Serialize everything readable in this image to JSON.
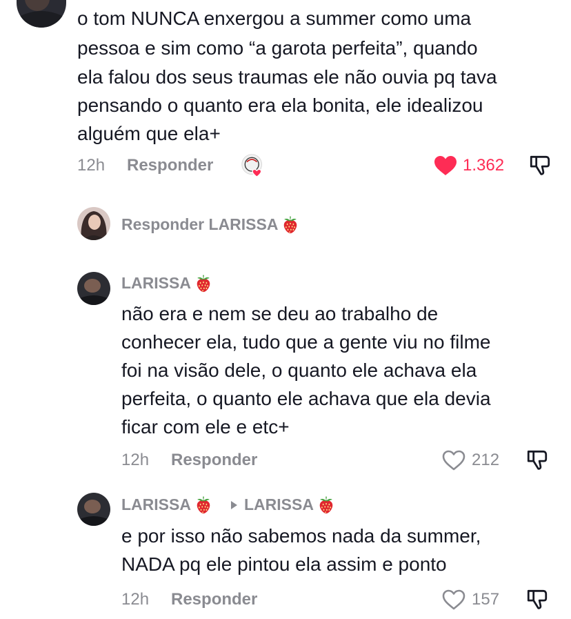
{
  "comment_main": {
    "lines": [
      "o tom NUNCA enxergou a summer como uma",
      "pessoa e sim como “a garota perfeita”, quando",
      "ela falou dos seus traumas ele não ouvia pq tava",
      "pensando o quanto era ela bonita, ele idealizou",
      "alguém que ela+"
    ],
    "time": "12h",
    "reply_label": "Responder",
    "like_count": "1.362",
    "liked": true,
    "like_color": "#fe2c55"
  },
  "reply_prompt": {
    "label": "Responder LARISSA"
  },
  "reply_1": {
    "username": "LARISSA",
    "lines": [
      "não era e nem se deu ao trabalho de",
      "conhecer ela, tudo que a gente viu no filme",
      "foi na visão dele, o quanto ele achava ela",
      "perfeita, o quanto ele achava que ela devia",
      "ficar com ele e etc+"
    ],
    "time": "12h",
    "reply_label": "Responder",
    "like_count": "212"
  },
  "reply_2": {
    "username": "LARISSA",
    "reply_to": "LARISSA",
    "lines": [
      "e por isso não sabemos nada da summer,",
      "NADA pq ele pintou ela assim e ponto"
    ],
    "time": "12h",
    "reply_label": "Responder",
    "like_count": "157"
  },
  "icons": {
    "heart_filled": "heart-filled-icon",
    "heart_outline": "heart-outline-icon",
    "dislike": "dislike-icon",
    "strawberry": "strawberry-emoji",
    "arrow": "triangle-right-icon"
  }
}
